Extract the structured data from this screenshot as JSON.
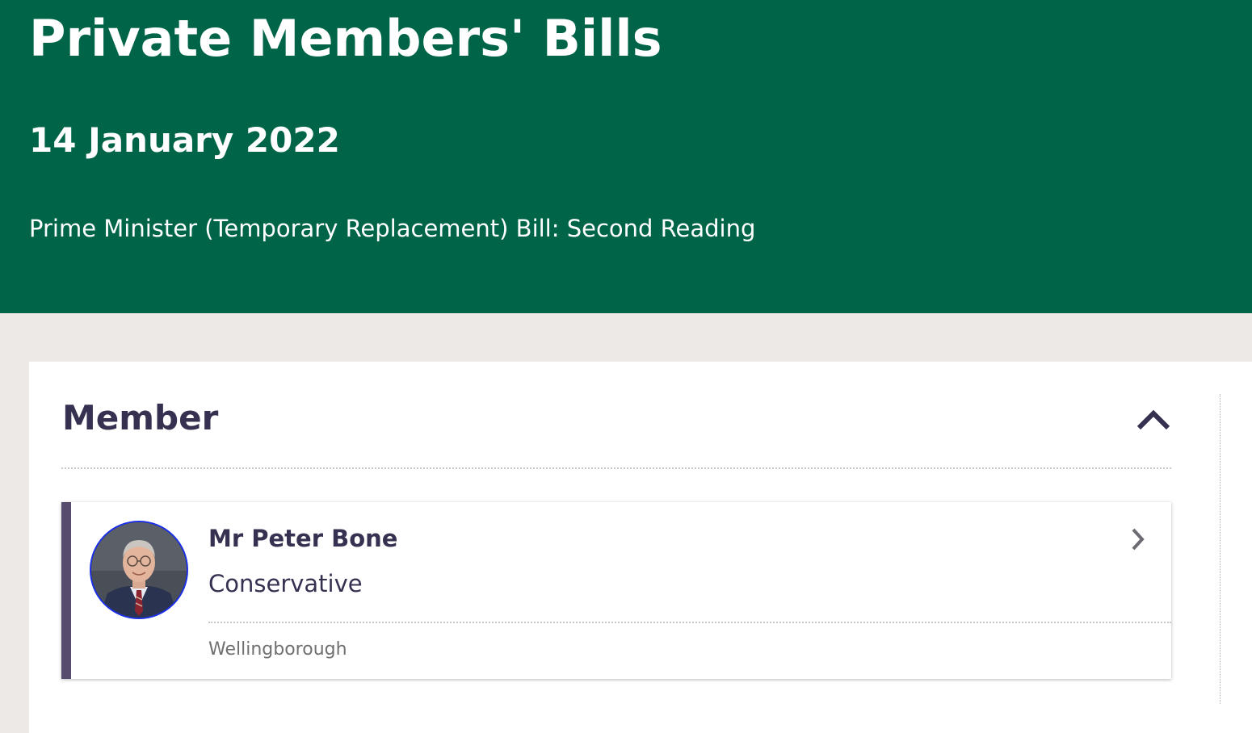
{
  "header": {
    "title": "Private Members' Bills",
    "date": "14 January 2022",
    "debate_title": "Prime Minister (Temporary Replacement) Bill: Second Reading"
  },
  "section": {
    "title": "Member",
    "toggle_icon": "chevron-up-icon",
    "member": {
      "name": "Mr Peter Bone",
      "party": "Conservative",
      "constituency": "Wellingborough",
      "party_color": "#1b2fe8",
      "link_icon": "chevron-right-icon"
    }
  },
  "colors": {
    "banner": "#006548",
    "heading_text": "#373151",
    "card_accent": "#574b6e",
    "page_background": "#ede9e7"
  }
}
